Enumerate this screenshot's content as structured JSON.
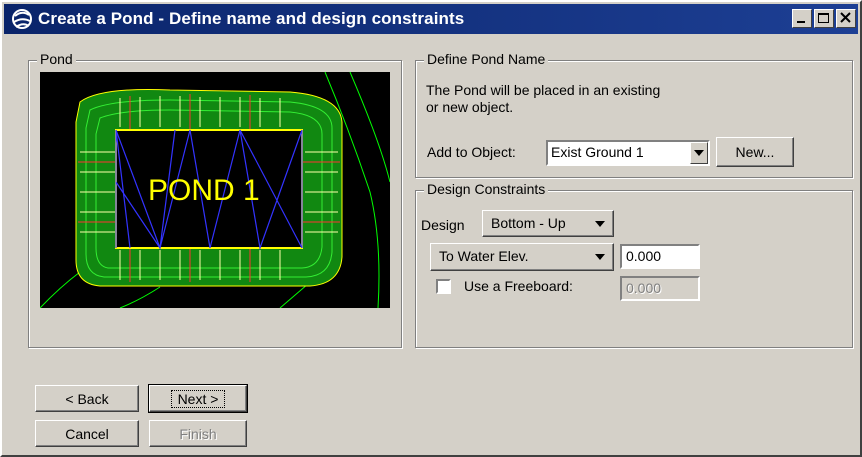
{
  "window": {
    "title": "Create a Pond - Define name and design constraints",
    "app_icon": "geopak-icon",
    "title_buttons": [
      "minimize-icon",
      "maximize-icon",
      "close-icon"
    ]
  },
  "pond_group": {
    "legend": "Pond",
    "preview_text": "POND  1"
  },
  "name_group": {
    "legend": "Define Pond Name",
    "description_line1": "The Pond will be placed in an existing",
    "description_line2": "or new object.",
    "add_to_object_label": "Add to Object:",
    "add_to_object_value": "Exist Ground 1",
    "new_button": "New..."
  },
  "constraints_group": {
    "legend": "Design Constraints",
    "design_label": "Design",
    "design_value": "Bottom - Up",
    "water_mode": "To Water Elev.",
    "water_value": "0.000",
    "freeboard_label": "Use a Freeboard:",
    "freeboard_checked": false,
    "freeboard_value": "0.000"
  },
  "buttons": {
    "back": "< Back",
    "next": "Next >",
    "cancel": "Cancel",
    "finish": "Finish"
  },
  "colors": {
    "titlebar": "#0a246a",
    "dialog_bg": "#d4d0c8",
    "preview_bg": "#000000",
    "pond_outline": "#ffff00",
    "slope_green": "#22cc22",
    "triangles": "#2222ff",
    "contours": "#00ff00"
  }
}
